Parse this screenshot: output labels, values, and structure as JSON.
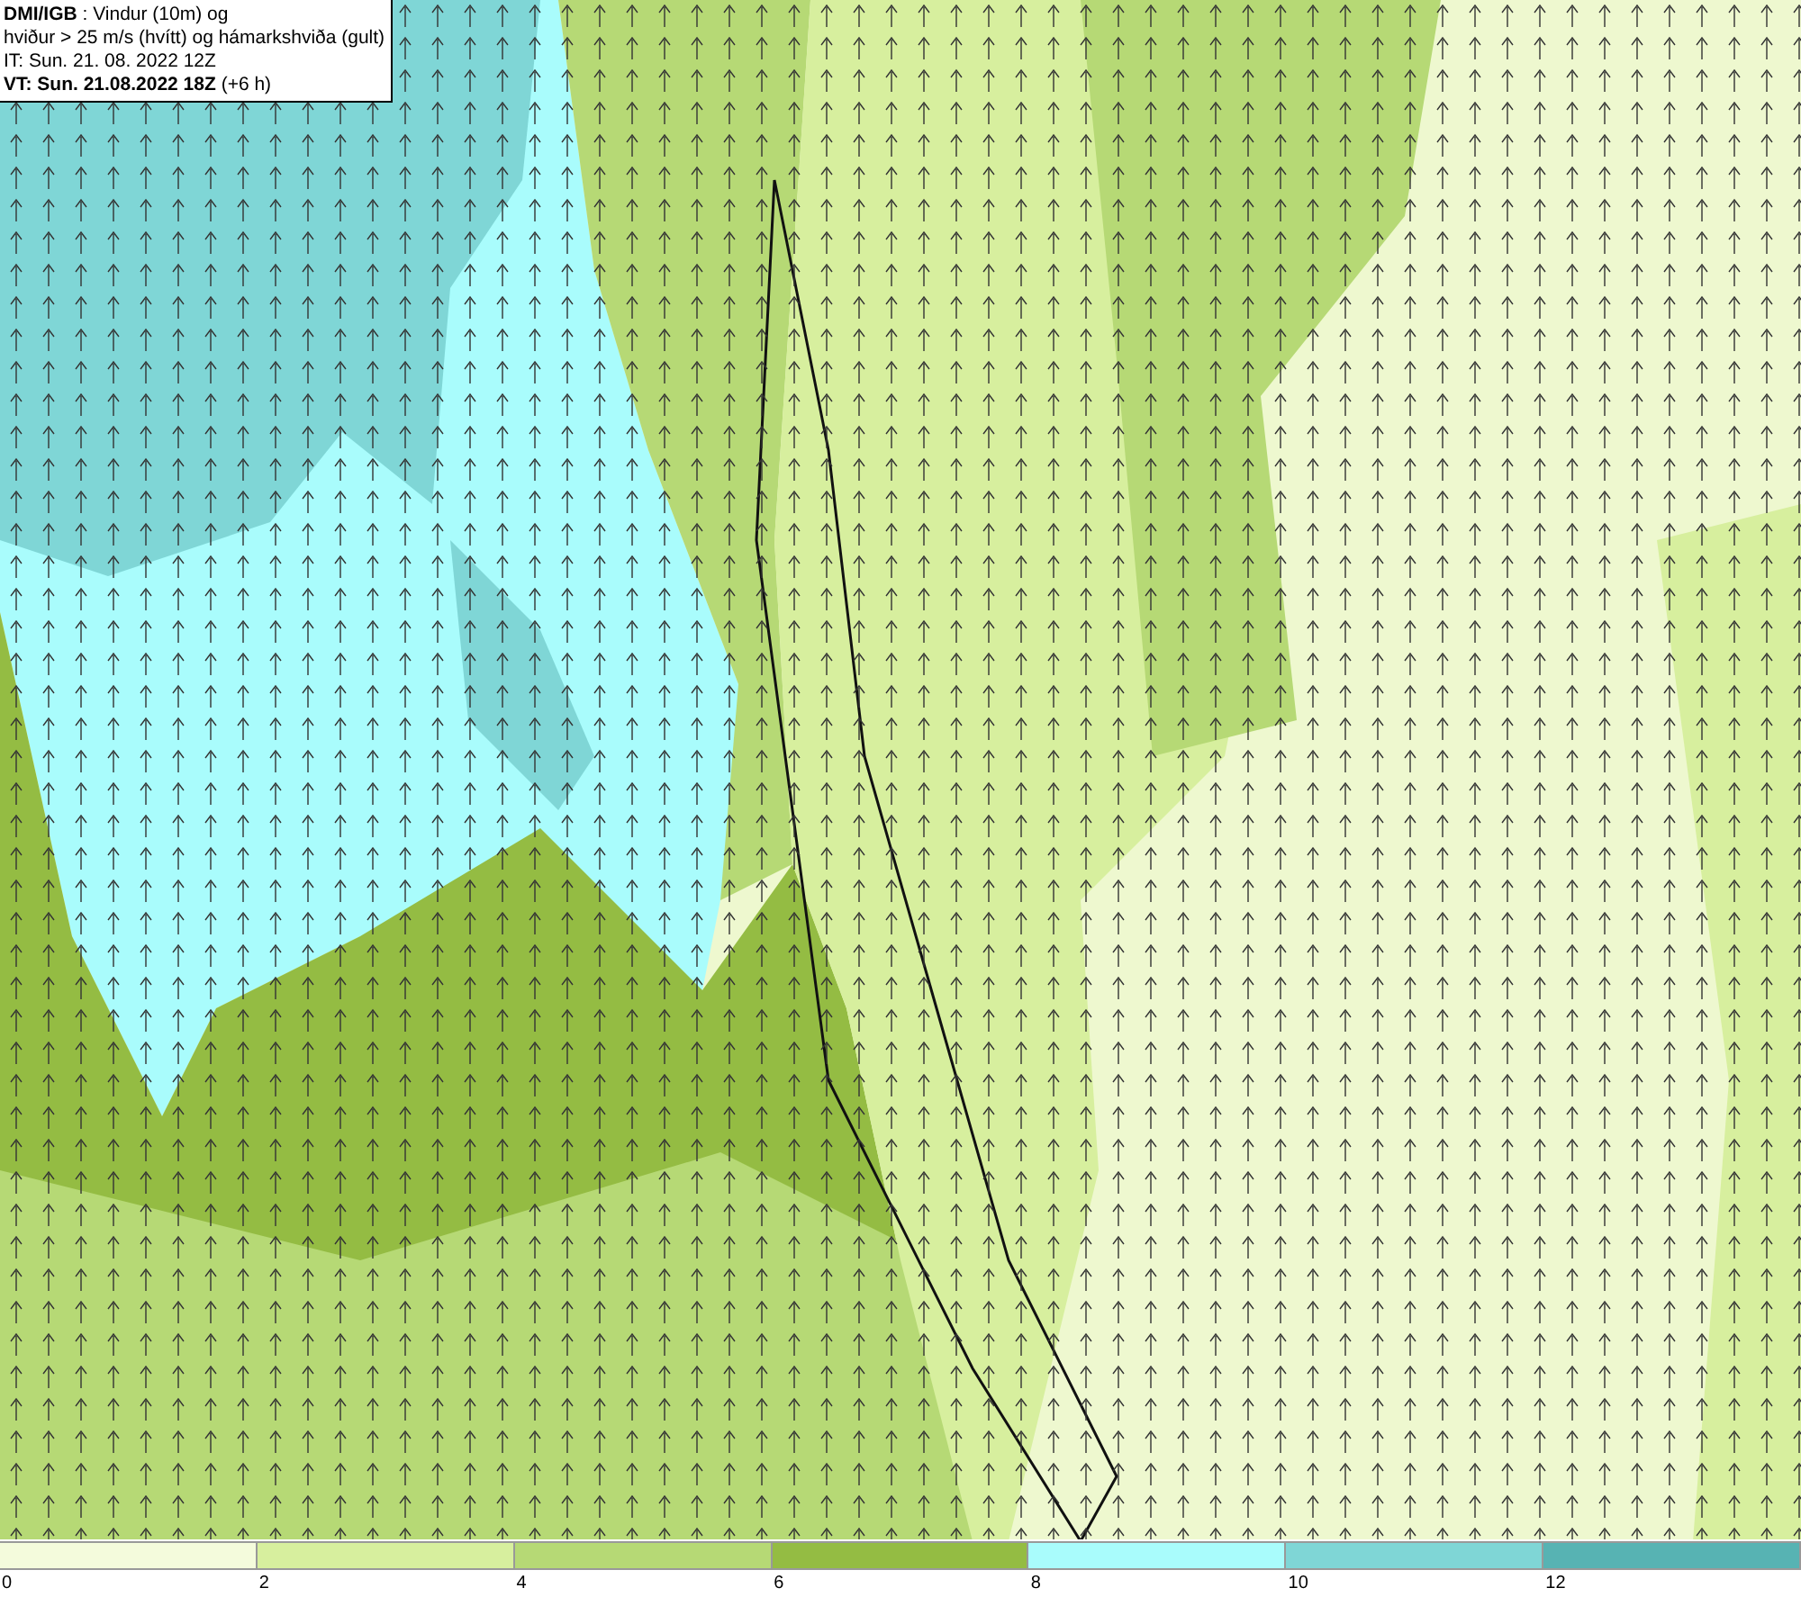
{
  "title_box": {
    "lines": [
      "**DMI/IGB** : Vindur (10m) og",
      "hviður > 25 m/s (hvítt) og hámarkshviða (gult)",
      "IT: Sun. 21. 08. 2022 12Z",
      "**VT: Sun. 21.08.2022 18Z** (+6 h)"
    ]
  },
  "legend": [
    {
      "label": "0",
      "color": "#f4fbdc"
    },
    {
      "label": "2",
      "color": "#d7ef9e"
    },
    {
      "label": "4",
      "color": "#b6d975"
    },
    {
      "label": "6",
      "color": "#94bc43"
    },
    {
      "label": "8",
      "color": "#a9fcfc"
    },
    {
      "label": "10",
      "color": "#7fd6d6"
    },
    {
      "label": "12",
      "color": "#57b3b3"
    }
  ]
}
